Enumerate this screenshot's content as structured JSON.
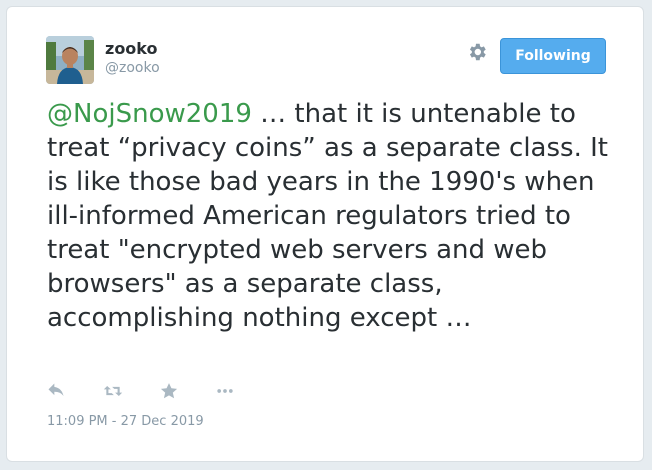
{
  "user": {
    "name": "zooko",
    "handle": "@zooko"
  },
  "follow_button": {
    "label": "Following",
    "color": "#55acee"
  },
  "tweet": {
    "mention": "@NojSnow2019",
    "mention_color": "#3a9a4c",
    "text": " … that it is untenable to treat “privacy coins” as a separate class. It is like those bad years in the 1990's when ill-informed American regulators tried to treat \"encrypted web servers and web browsers\" as a separate class, accomplishing nothing except …",
    "timestamp": "11:09 PM - 27 Dec 2019"
  },
  "actions": [
    {
      "icon": "reply-icon"
    },
    {
      "icon": "retweet-icon"
    },
    {
      "icon": "favorite-star-icon"
    },
    {
      "icon": "more-icon"
    }
  ],
  "icons": {
    "settings": "gear-icon"
  }
}
